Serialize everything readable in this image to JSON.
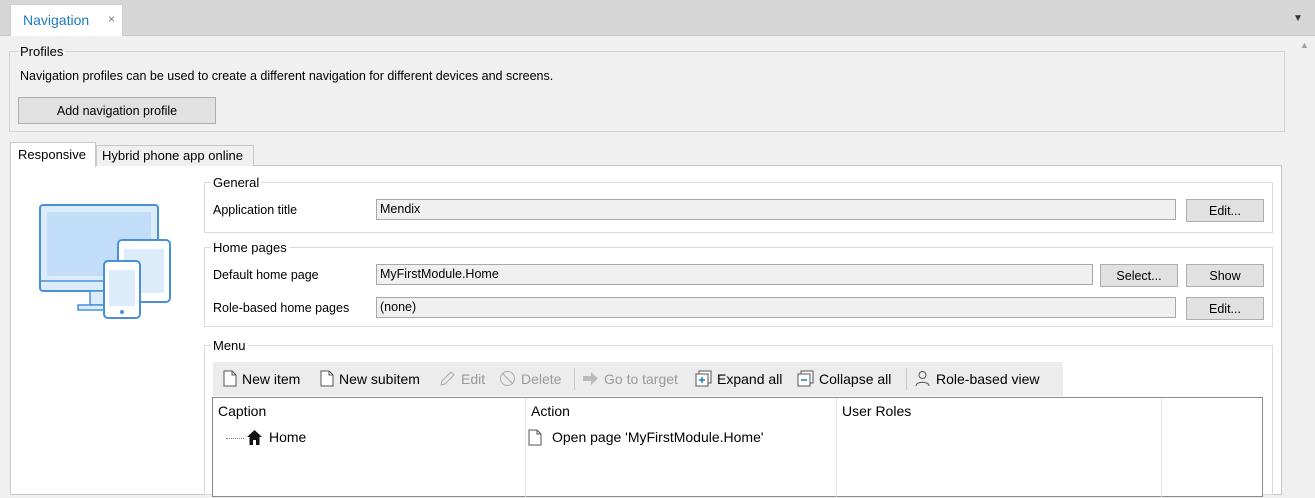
{
  "document_tab": {
    "label": "Navigation",
    "close": "×"
  },
  "profiles": {
    "title": "Profiles",
    "description": "Navigation profiles can be used to create a different navigation for different devices and screens.",
    "add_button": "Add navigation profile"
  },
  "profile_tabs": [
    {
      "label": "Responsive",
      "selected": true
    },
    {
      "label": "Hybrid phone app online",
      "selected": false
    }
  ],
  "general": {
    "title": "General",
    "application_title_label": "Application title",
    "application_title_value": "Mendix",
    "edit_button": "Edit..."
  },
  "home_pages": {
    "title": "Home pages",
    "default_label": "Default home page",
    "default_value": "MyFirstModule.Home",
    "select_button": "Select...",
    "show_button": "Show",
    "role_label": "Role-based home pages",
    "role_value": "(none)",
    "role_edit_button": "Edit..."
  },
  "menu": {
    "title": "Menu",
    "toolbar": {
      "new_item": "New item",
      "new_subitem": "New subitem",
      "edit": "Edit",
      "delete": "Delete",
      "go_to_target": "Go to target",
      "expand_all": "Expand all",
      "collapse_all": "Collapse all",
      "role_based_view": "Role-based view"
    },
    "columns": [
      "Caption",
      "Action",
      "User Roles"
    ],
    "rows": [
      {
        "caption": "Home",
        "action": "Open page 'MyFirstModule.Home'",
        "user_roles": ""
      }
    ]
  },
  "colors": {
    "accent": "#1c7bc0",
    "icon_blue": "#4a90d9"
  }
}
